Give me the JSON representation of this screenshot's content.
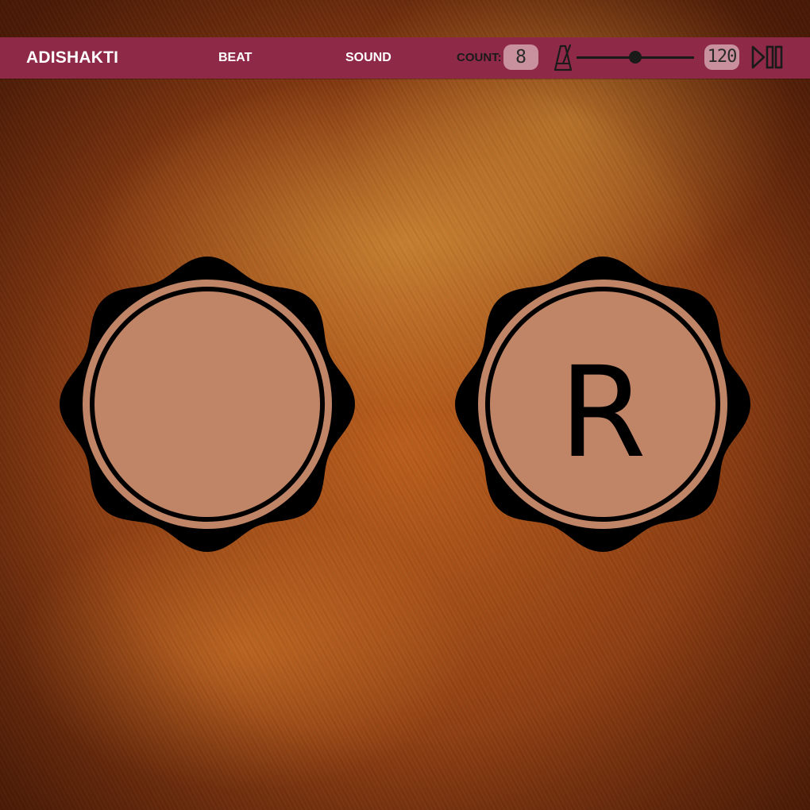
{
  "app": {
    "brand": "ADISHAKTI"
  },
  "nav": {
    "beat_label": "BEAT",
    "sound_label": "SOUND"
  },
  "controls": {
    "count_label": "COUNT:",
    "count_value": "8",
    "tempo_value": "120",
    "tempo_slider_fraction": 0.5,
    "icons": {
      "metronome": "metronome-icon",
      "play_pause": "play-pause-icon"
    }
  },
  "pads": {
    "left_label": "",
    "right_label": "R"
  },
  "colors": {
    "topbar": "#8e2a48",
    "pill": "#c9919e",
    "pad_fill": "#c08466",
    "pad_ring": "#000000"
  }
}
